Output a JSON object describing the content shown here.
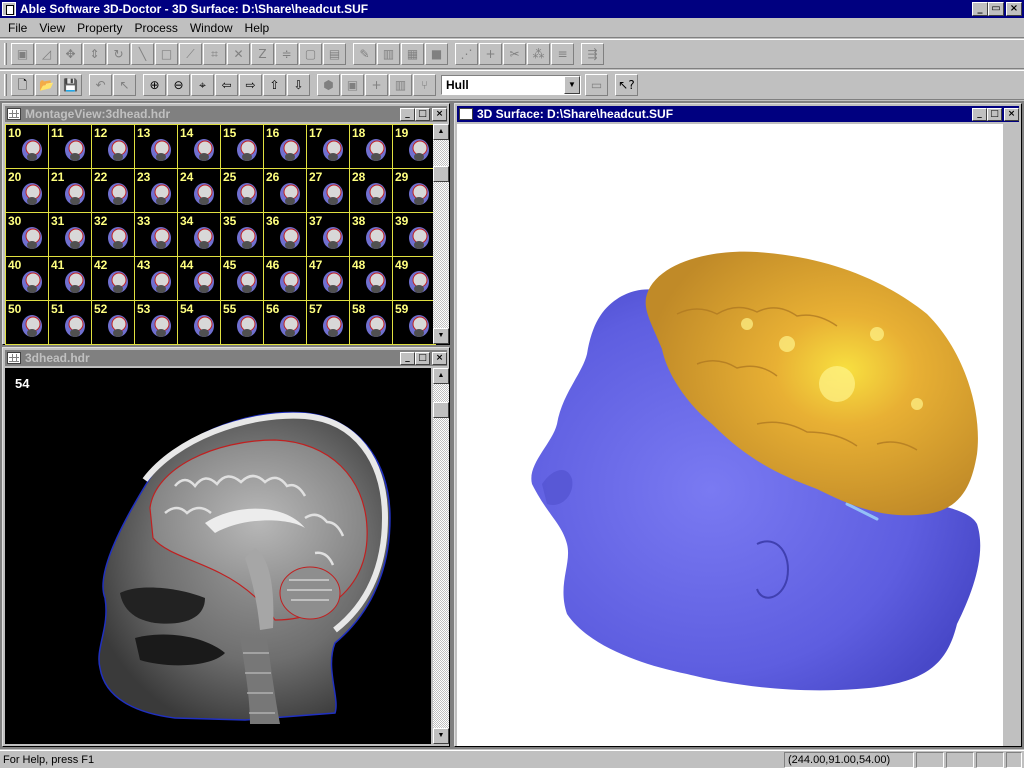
{
  "app": {
    "title": "Able Software 3D-Doctor - 3D Surface: D:\\Share\\headcut.SUF",
    "window_buttons": [
      "_",
      "▭",
      "×"
    ]
  },
  "menu": [
    {
      "label": "File"
    },
    {
      "label": "View"
    },
    {
      "label": "Property"
    },
    {
      "label": "Process"
    },
    {
      "label": "Window"
    },
    {
      "label": "Help"
    }
  ],
  "toolbar1": {
    "icons": [
      "rect-select-icon",
      "polygon-icon",
      "move-icon",
      "resize-icon",
      "rotate-icon",
      "line-icon",
      "box-icon",
      "measure-icon",
      "crop-icon",
      "delete-icon",
      "zoom-z-icon",
      "align-icon",
      "frame-icon",
      "image-icon",
      "pencil-icon",
      "fill-icon",
      "draw-icon",
      "paint-icon",
      "node-icon",
      "add-node-icon",
      "remove-node-icon",
      "group-icon",
      "order-icon",
      "export-icon"
    ]
  },
  "toolbar2": {
    "icons": [
      "new-file-icon",
      "open-folder-icon",
      "save-icon",
      "undo-icon",
      "pointer-icon",
      "zoom-in-icon",
      "zoom-out-icon",
      "pan-icon",
      "left-arrow-icon",
      "right-arrow-icon",
      "up-arrow-icon",
      "down-arrow-icon",
      "render-icon",
      "fit-icon",
      "plus-icon",
      "barcode-icon",
      "branch-icon"
    ],
    "combo_value": "Hull",
    "after_icons": [
      "apply-icon",
      "context-help-icon"
    ]
  },
  "windows": {
    "montage": {
      "title": "MontageView:3dhead.hdr",
      "slices": [
        10,
        11,
        12,
        13,
        14,
        15,
        16,
        17,
        18,
        19,
        20,
        21,
        22,
        23,
        24,
        25,
        26,
        27,
        28,
        29,
        30,
        31,
        32,
        33,
        34,
        35,
        36,
        37,
        38,
        39,
        40,
        41,
        42,
        43,
        44,
        45,
        46,
        47,
        48,
        49,
        50,
        51,
        52,
        53,
        54,
        55,
        56,
        57,
        58,
        59
      ]
    },
    "slice": {
      "title": "3dhead.hdr",
      "slice_number": "54"
    },
    "surface": {
      "title": "3D Surface: D:\\Share\\headcut.SUF",
      "skin_color": "#6a6ae8",
      "brain_color": "#e8a830"
    }
  },
  "status": {
    "help_text": "For Help, press F1",
    "coords": "(244.00,91.00,54.00)"
  }
}
